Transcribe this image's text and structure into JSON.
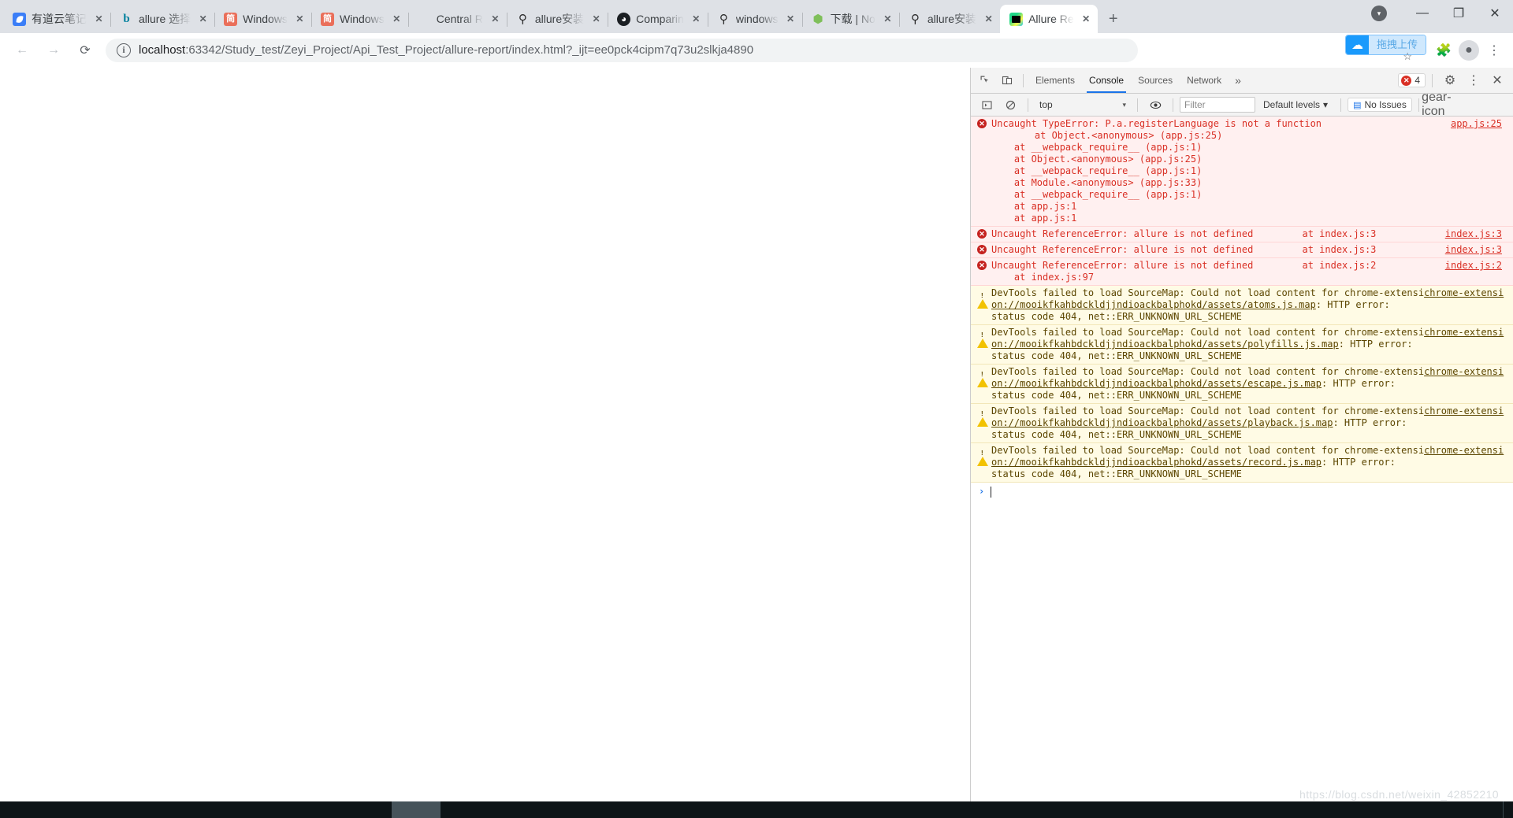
{
  "browser": {
    "tabs": [
      {
        "title": "有道云笔记",
        "favicon": "youdao-note-icon",
        "active": false
      },
      {
        "title": "allure 选择",
        "favicon": "bing-icon",
        "active": false
      },
      {
        "title": "Windows",
        "favicon": "jianshu-icon",
        "active": false
      },
      {
        "title": "Windows",
        "favicon": "jianshu-icon",
        "active": false
      },
      {
        "title": "Central R",
        "favicon": "none-icon",
        "active": false
      },
      {
        "title": "allure安装",
        "favicon": "allure-icon",
        "active": false
      },
      {
        "title": "Comparin",
        "favicon": "github-icon",
        "active": false
      },
      {
        "title": "windows",
        "favicon": "allure-icon",
        "active": false
      },
      {
        "title": "下载 | No",
        "favicon": "nodejs-icon",
        "active": false
      },
      {
        "title": "allure安装",
        "favicon": "allure-icon",
        "active": false
      },
      {
        "title": "Allure Re",
        "favicon": "pycharm-icon",
        "active": true
      }
    ],
    "new_tab_label": "+",
    "close_label": "✕",
    "window_controls": {
      "minimize": "—",
      "restore": "❐",
      "close": "✕",
      "extra": "▾"
    },
    "nav": {
      "back": "←",
      "forward": "→",
      "reload": "⟳"
    },
    "omnibox": {
      "info_icon_label": "ⓘ",
      "host": "localhost",
      "path": ":63342/Study_test/Zeyi_Project/Api_Test_Project/allure-report/index.html?_ijt=ee0pck4cipm7q73u2slkja4890",
      "full_url": "localhost:63342/Study_test/Zeyi_Project/Api_Test_Project/allure-report/index.html?_ijt=ee0pck4cipm7q73u2slkja4890"
    },
    "extension_badge": {
      "label": "拖拽上传",
      "icon": "cloud-upload-icon",
      "accent": "#1a9afc",
      "bg": "#cfe8fd"
    },
    "toolbar_icons": {
      "bookmark": "☆",
      "extensions": "🧩",
      "profile": "person-icon",
      "menu": "⋮"
    }
  },
  "devtools": {
    "inspect_icon": "inspect-element-icon",
    "device_icon": "device-toolbar-icon",
    "tabs": [
      {
        "label": "Elements",
        "active": false
      },
      {
        "label": "Console",
        "active": true
      },
      {
        "label": "Sources",
        "active": false
      },
      {
        "label": "Network",
        "active": false
      }
    ],
    "more_tabs_label": "»",
    "error_count": "4",
    "settings_label": "⚙",
    "menu_label": "⋮",
    "close_label": "✕",
    "filterbar": {
      "sidebar_toggle": "console-sidebar-icon",
      "clear_label": "clear-console-icon",
      "context": "top",
      "context_caret": "▾",
      "eye_icon": "live-expression-icon",
      "filter_placeholder": "Filter",
      "levels_label": "Default levels",
      "levels_caret": "▾",
      "issues_label": "No Issues",
      "issues_icon": "issues-icon",
      "settings_icon": "gear-icon"
    },
    "messages": [
      {
        "type": "error",
        "text": "Uncaught TypeError: P.a.registerLanguage is not a function",
        "source": "app.js:25",
        "stack": [
          "    at Object.<anonymous> (app.js:25)",
          "    at __webpack_require__ (app.js:1)",
          "    at Object.<anonymous> (app.js:25)",
          "    at __webpack_require__ (app.js:1)",
          "    at Module.<anonymous> (app.js:33)",
          "    at __webpack_require__ (app.js:1)",
          "    at app.js:1",
          "    at app.js:1"
        ]
      },
      {
        "type": "error",
        "text": "Uncaught ReferenceError: allure is not defined",
        "source": "index.js:3",
        "stack": [
          "    at index.js:3"
        ]
      },
      {
        "type": "error",
        "text": "Uncaught ReferenceError: allure is not defined",
        "source": "index.js:3",
        "stack": [
          "    at index.js:3"
        ]
      },
      {
        "type": "error",
        "text": "Uncaught ReferenceError: allure is not defined",
        "source": "index.js:2",
        "stack": [
          "    at index.js:2",
          "    at index.js:97"
        ]
      },
      {
        "type": "warn",
        "line1": "DevTools failed to load SourceMap: Could not load content for chrome-extensi",
        "line2": "on://mooikfkahbdckldjjndioackbalphokd/assets/atoms.js.map",
        "line2_tail": ": HTTP error:",
        "line3": "status code 404, net::ERR_UNKNOWN_URL_SCHEME"
      },
      {
        "type": "warn",
        "line1": "DevTools failed to load SourceMap: Could not load content for chrome-extensi",
        "line2": "on://mooikfkahbdckldjjndioackbalphokd/assets/polyfills.js.map",
        "line2_tail": ": HTTP error:",
        "line3": "status code 404, net::ERR_UNKNOWN_URL_SCHEME"
      },
      {
        "type": "warn",
        "line1": "DevTools failed to load SourceMap: Could not load content for chrome-extensi",
        "line2": "on://mooikfkahbdckldjjndioackbalphokd/assets/escape.js.map",
        "line2_tail": ": HTTP error:",
        "line3": "status code 404, net::ERR_UNKNOWN_URL_SCHEME"
      },
      {
        "type": "warn",
        "line1": "DevTools failed to load SourceMap: Could not load content for chrome-extensi",
        "line2": "on://mooikfkahbdckldjjndioackbalphokd/assets/playback.js.map",
        "line2_tail": ": HTTP error:",
        "line3": "status code 404, net::ERR_UNKNOWN_URL_SCHEME"
      },
      {
        "type": "warn",
        "line1": "DevTools failed to load SourceMap: Could not load content for chrome-extensi",
        "line2": "on://mooikfkahbdckldjjndioackbalphokd/assets/record.js.map",
        "line2_tail": ": HTTP error:",
        "line3": "status code 404, net::ERR_UNKNOWN_URL_SCHEME"
      }
    ],
    "prompt_chevron": "›"
  },
  "watermark": "https://blog.csdn.net/weixin_42852210"
}
